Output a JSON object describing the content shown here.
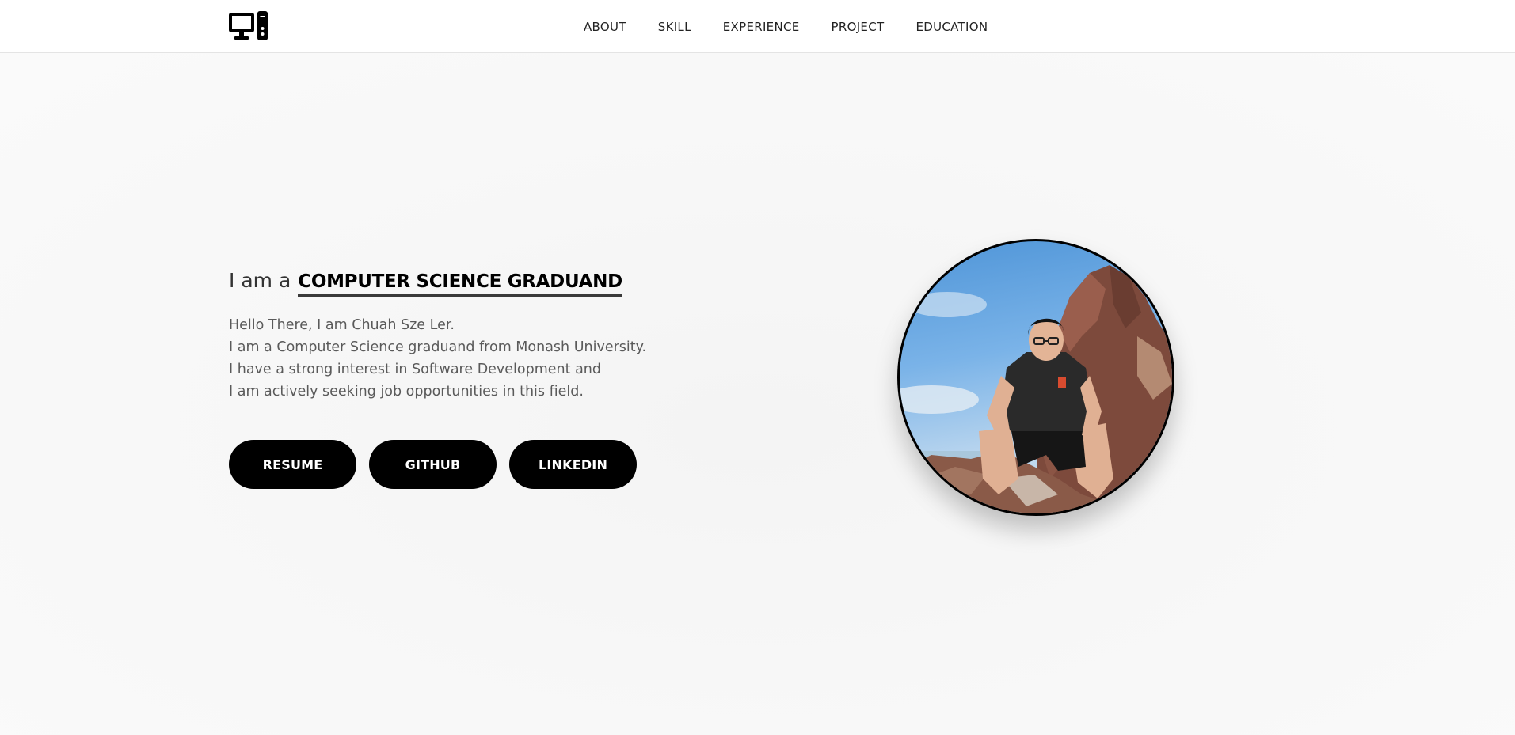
{
  "header": {
    "logo_icon": "desktop-computer-icon",
    "nav": [
      {
        "label": "ABOUT"
      },
      {
        "label": "SKILL"
      },
      {
        "label": "EXPERIENCE"
      },
      {
        "label": "PROJECT"
      },
      {
        "label": "EDUCATION"
      }
    ]
  },
  "hero": {
    "headline_prefix": "I am a",
    "headline_role": "COMPUTER SCIENCE GRADUAND",
    "intro_lines": [
      "Hello There, I am Chuah Sze Ler.",
      "I am a Computer Science graduand from Monash University.",
      "I have a strong interest in Software Development and",
      "I am actively seeking job opportunities in this field."
    ],
    "buttons": {
      "resume": "RESUME",
      "github": "GITHUB",
      "linkedin": "LINKEDIN"
    },
    "photo_icon": "profile-photo"
  },
  "colors": {
    "accent": "#000000",
    "text": "#5a5a5a",
    "background": "#f7f7f7"
  }
}
